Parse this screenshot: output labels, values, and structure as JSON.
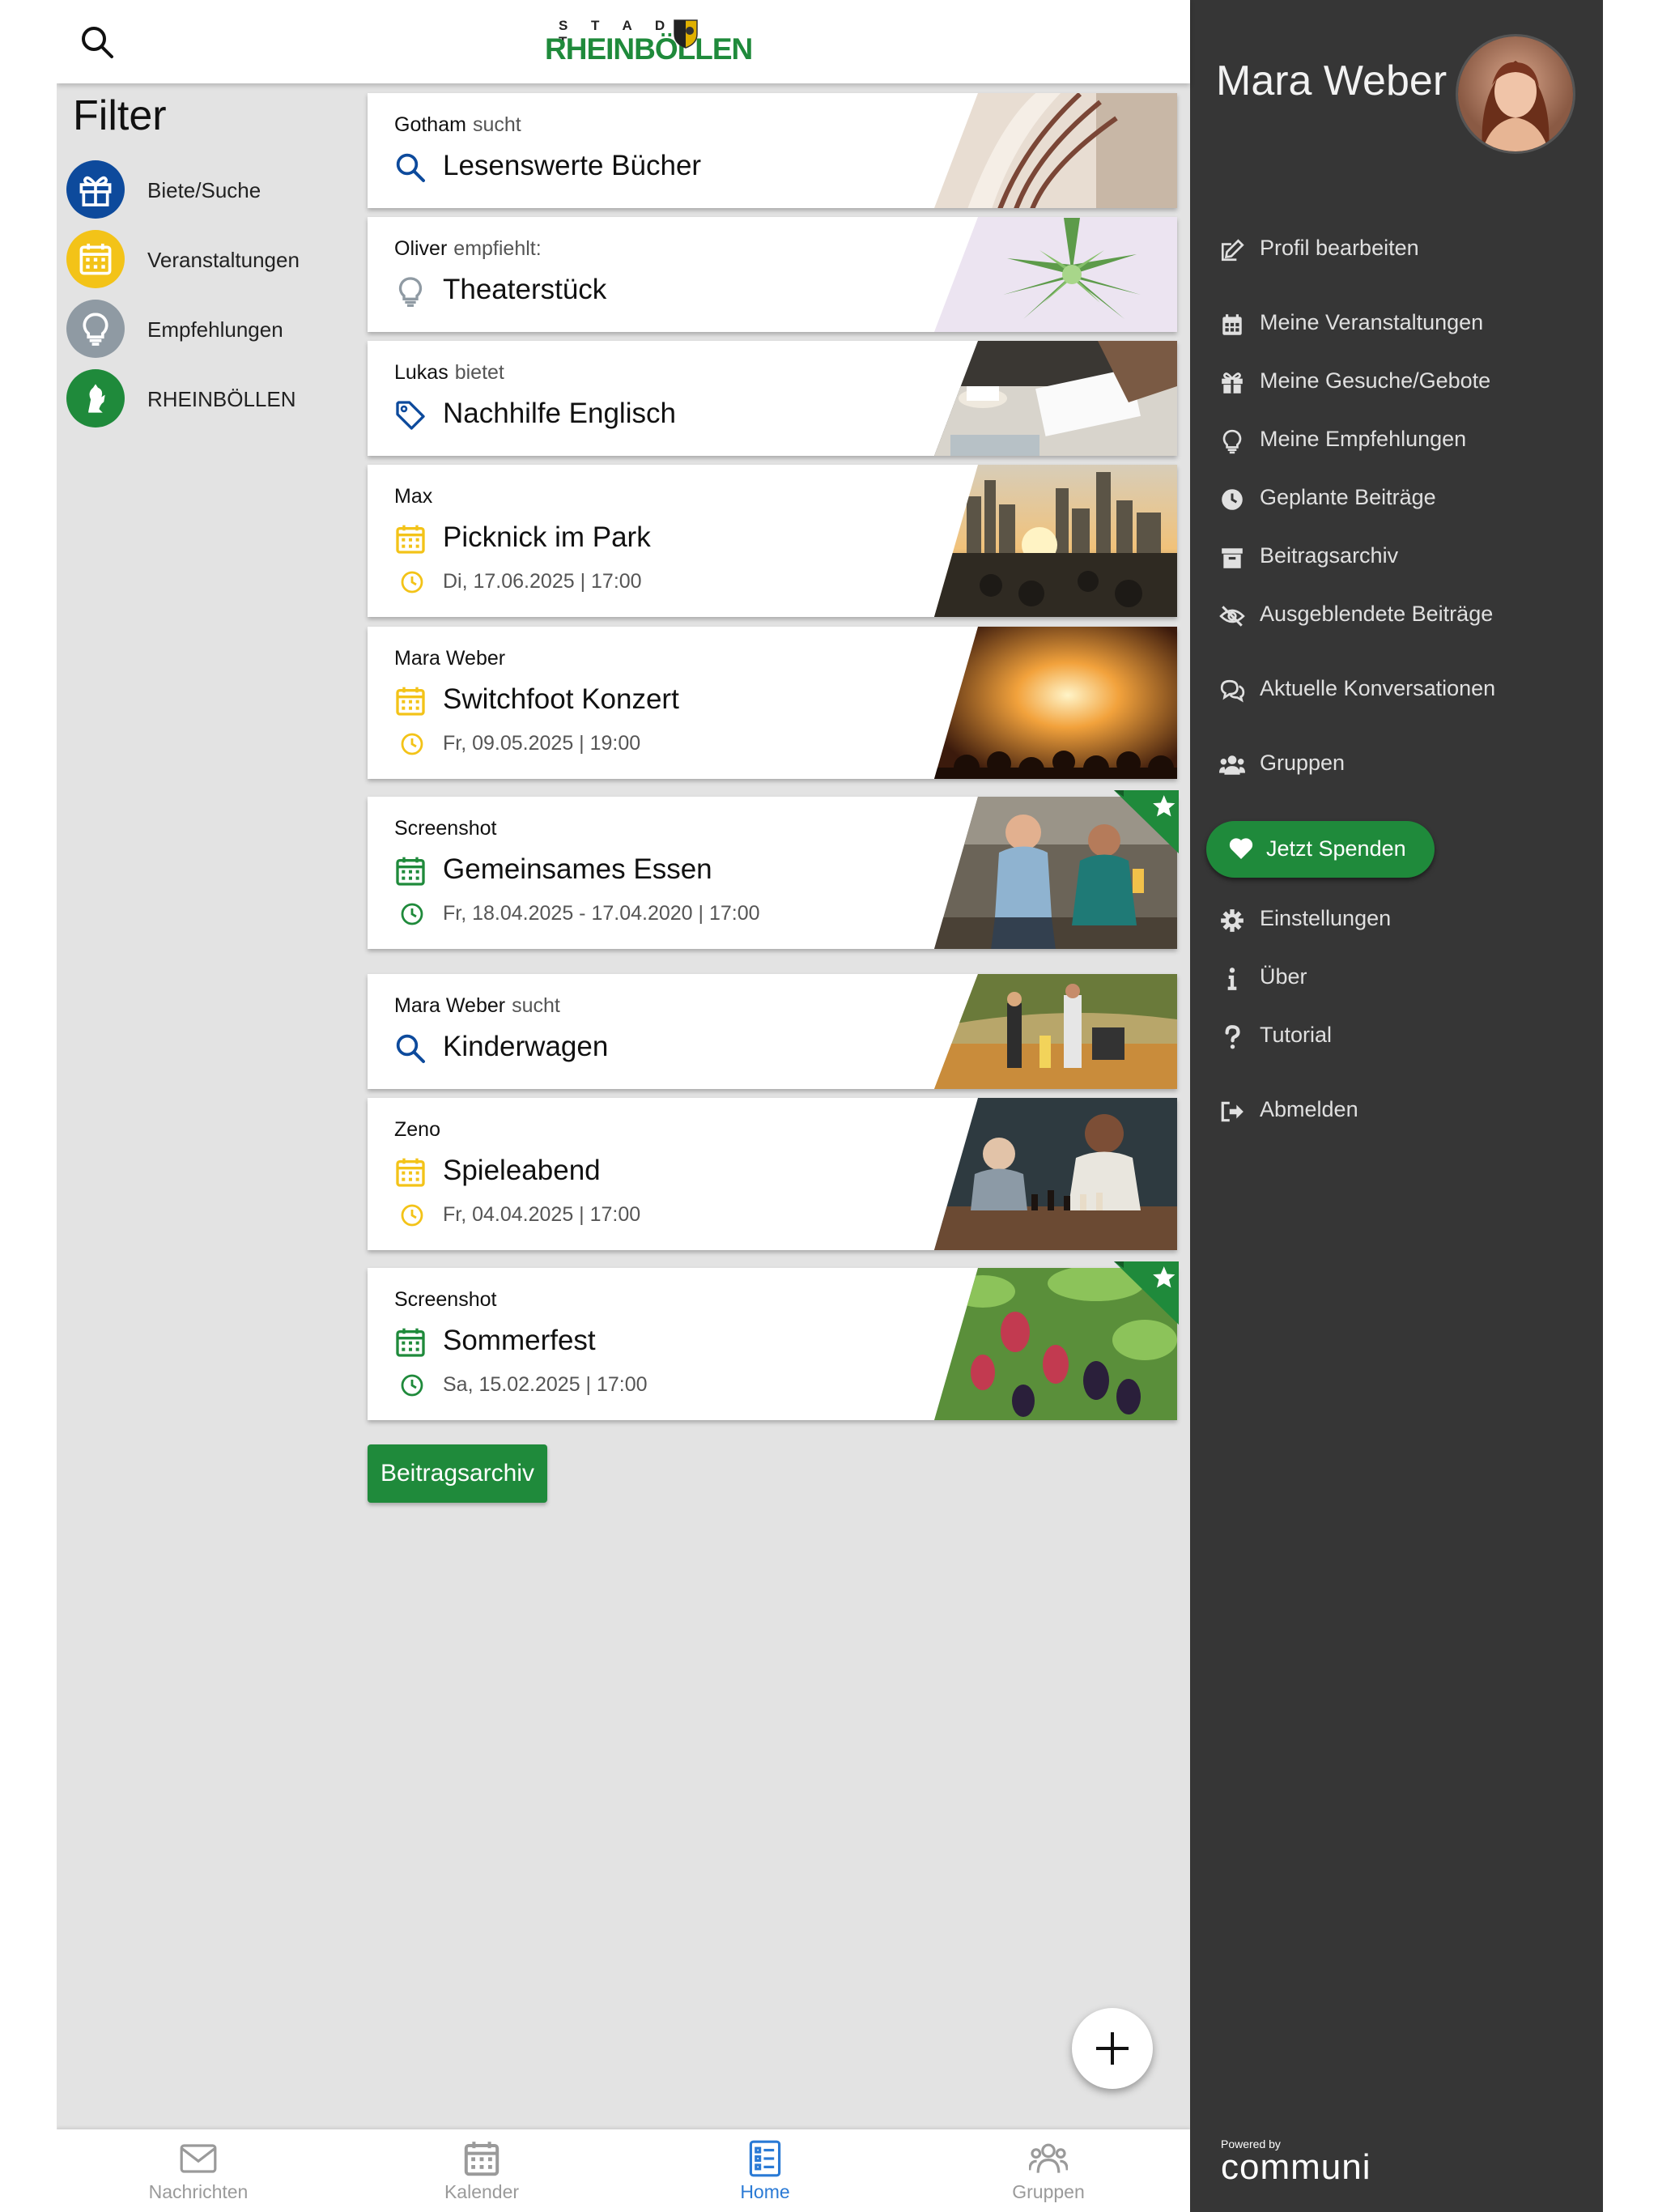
{
  "header": {
    "logo_top": "S T A D T",
    "logo_main": "RHEINBÖLLEN"
  },
  "filter": {
    "title": "Filter",
    "items": [
      {
        "label": "Biete/Suche",
        "color": "#0d4a9c",
        "icon": "gift-icon"
      },
      {
        "label": "Veranstaltungen",
        "color": "#f3c318",
        "icon": "calendar-icon"
      },
      {
        "label": "Empfehlungen",
        "color": "#8f9aa3",
        "icon": "lightbulb-icon"
      },
      {
        "label": "RHEINBÖLLEN",
        "color": "#1f8a3b",
        "icon": "crest-lion-icon"
      }
    ]
  },
  "feed": [
    {
      "author": "Gotham",
      "verb": "sucht",
      "title": "Lesenswerte Bücher",
      "type": "search",
      "image": "book-pages"
    },
    {
      "author": "Oliver",
      "verb": "empfiehlt:",
      "title": "Theaterstück",
      "type": "recommend",
      "image": "succulent"
    },
    {
      "author": "Lukas",
      "verb": "bietet",
      "title": "Nachhilfe Englisch",
      "type": "offer",
      "image": "desk-study"
    },
    {
      "author": "Max",
      "verb": "",
      "title": "Picknick im Park",
      "type": "event-yellow",
      "date": "Di, 17.06.2025 | 17:00",
      "image": "city-sunset"
    },
    {
      "author": "Mara Weber",
      "verb": "",
      "title": "Switchfoot Konzert",
      "type": "event-yellow",
      "date": "Fr, 09.05.2025 | 19:00",
      "image": "concert"
    },
    {
      "author": "Screenshot",
      "verb": "",
      "title": "Gemeinsames Essen",
      "type": "event-green",
      "date": "Fr, 18.04.2025 - 17.04.2020 | 17:00",
      "image": "women-laughing",
      "starred": true
    },
    {
      "author": "Mara Weber",
      "verb": "sucht",
      "title": "Kinderwagen",
      "type": "search",
      "image": "family-park"
    },
    {
      "author": "Zeno",
      "verb": "",
      "title": "Spieleabend",
      "type": "event-yellow",
      "date": "Fr, 04.04.2025 | 17:00",
      "image": "chess"
    },
    {
      "author": "Screenshot",
      "verb": "",
      "title": "Sommerfest",
      "type": "event-green",
      "date": "Sa, 15.02.2025 | 17:00",
      "image": "berries",
      "starred": true
    }
  ],
  "archive_button": "Beitragsarchiv",
  "bottom_nav": [
    {
      "label": "Nachrichten",
      "icon": "envelope-icon",
      "active": false
    },
    {
      "label": "Kalender",
      "icon": "calendar-icon",
      "active": false
    },
    {
      "label": "Home",
      "icon": "list-icon",
      "active": true
    },
    {
      "label": "Gruppen",
      "icon": "group-icon",
      "active": false
    }
  ],
  "drawer": {
    "user_name": "Mara Weber",
    "menu": [
      {
        "label": "Profil bearbeiten",
        "icon": "edit-icon"
      },
      {
        "label": "Meine Veranstaltungen",
        "icon": "calendar-icon"
      },
      {
        "label": "Meine Gesuche/Gebote",
        "icon": "gift-icon"
      },
      {
        "label": "Meine Empfehlungen",
        "icon": "lightbulb-icon"
      },
      {
        "label": "Geplante Beiträge",
        "icon": "clock-icon"
      },
      {
        "label": "Beitragsarchiv",
        "icon": "archive-icon"
      },
      {
        "label": "Ausgeblendete Beiträge",
        "icon": "eye-slash-icon"
      },
      {
        "label": "Aktuelle Konversationen",
        "icon": "chat-icon"
      },
      {
        "label": "Gruppen",
        "icon": "users-icon"
      }
    ],
    "donate": "Jetzt Spenden",
    "menu2": [
      {
        "label": "Einstellungen",
        "icon": "gear-icon"
      },
      {
        "label": "Über",
        "icon": "info-icon"
      },
      {
        "label": "Tutorial",
        "icon": "question-icon"
      },
      {
        "label": "Abmelden",
        "icon": "logout-icon"
      }
    ],
    "powered_by": "Powered by",
    "brand": "communi"
  },
  "colors": {
    "green": "#1f8a3b",
    "yellow": "#f3c318",
    "blue": "#0d4a9c",
    "active_nav": "#2a7ad5",
    "drawer_bg": "#363636"
  }
}
